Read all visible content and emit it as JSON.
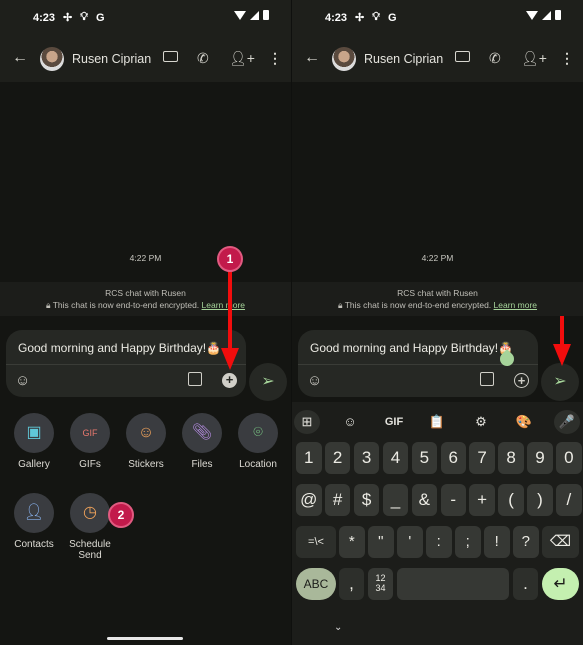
{
  "status": {
    "time": "4:23",
    "icons": [
      "fan-icon",
      "bulb-icon",
      "google-icon"
    ],
    "right_icons": [
      "wifi-icon",
      "signal-icon",
      "battery-icon"
    ]
  },
  "header": {
    "contact": "Rusen Ciprian",
    "icons": [
      "back-arrow-icon",
      "video-call-icon",
      "phone-icon",
      "add-person-icon",
      "more-vert-icon"
    ]
  },
  "chat": {
    "time": "4:22 PM",
    "banner_title": "RCS chat with Rusen",
    "banner_text": "This chat is now end-to-end encrypted.",
    "learn_more": "Learn more"
  },
  "compose": {
    "message": "Good morning and Happy Birthday!🎂"
  },
  "attachments": [
    {
      "label": "Gallery",
      "icon": "gallery-icon",
      "color": "#5fc8d8"
    },
    {
      "label": "GIFs",
      "icon": "gif-icon",
      "color": "#e8786e"
    },
    {
      "label": "Stickers",
      "icon": "sticker-icon",
      "color": "#efa25a"
    },
    {
      "label": "Files",
      "icon": "paperclip-icon",
      "color": "#b48ce0"
    },
    {
      "label": "Location",
      "icon": "location-pin-icon",
      "color": "#7fd48a"
    },
    {
      "label": "Contacts",
      "icon": "contact-icon",
      "color": "#8ab4f0"
    },
    {
      "label": "Schedule Send",
      "icon": "clock-icon",
      "color": "#efa25a"
    }
  ],
  "annotations": {
    "step1": "1",
    "step2": "2"
  },
  "keyboard": {
    "toolbar": [
      "⊞",
      "☺",
      "GIF",
      "📋",
      "⚙",
      "🎨",
      "🎤"
    ],
    "row1": [
      "1",
      "2",
      "3",
      "4",
      "5",
      "6",
      "7",
      "8",
      "9",
      "0"
    ],
    "row2": [
      "@",
      "#",
      "$",
      "_",
      "&",
      "-",
      "+",
      "(",
      ")",
      "/"
    ],
    "row3": [
      "=\\<",
      "*",
      "\"",
      "'",
      ":",
      ";",
      "!",
      "?",
      "⌫"
    ],
    "row4": [
      "ABC",
      ",",
      "12\n34",
      "",
      ".",
      "↵"
    ]
  },
  "colors": {
    "accent_green": "#a6d49a",
    "annotation_red": "#f20d0d",
    "badge": "#c21a4b"
  }
}
